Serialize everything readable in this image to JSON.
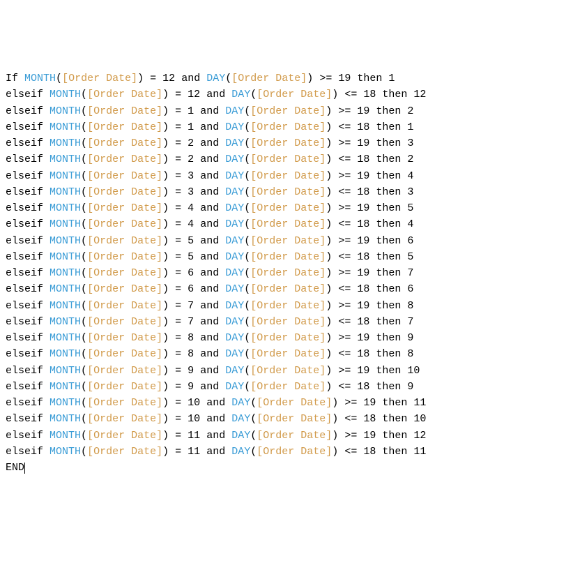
{
  "tokens": {
    "If": "If",
    "elseif": "elseif",
    "and": "and",
    "then": "then",
    "END": "END",
    "MONTH": "MONTH",
    "DAY": "DAY",
    "lp": "(",
    "rp": ")",
    "field": "[Order Date]",
    "eq": "=",
    "ge": ">=",
    "le": "<="
  },
  "lines": [
    {
      "lead": "If",
      "m": "12",
      "cmp": ">=",
      "d": "19",
      "r": "1"
    },
    {
      "lead": "elseif",
      "m": "12",
      "cmp": "<=",
      "d": "18",
      "r": "12"
    },
    {
      "lead": "elseif",
      "m": "1",
      "cmp": ">=",
      "d": "19",
      "r": "2"
    },
    {
      "lead": "elseif",
      "m": "1",
      "cmp": "<=",
      "d": "18",
      "r": "1"
    },
    {
      "lead": "elseif",
      "m": "2",
      "cmp": ">=",
      "d": "19",
      "r": "3"
    },
    {
      "lead": "elseif",
      "m": "2",
      "cmp": "<=",
      "d": "18",
      "r": "2"
    },
    {
      "lead": "elseif",
      "m": "3",
      "cmp": ">=",
      "d": "19",
      "r": "4"
    },
    {
      "lead": "elseif",
      "m": "3",
      "cmp": "<=",
      "d": "18",
      "r": "3"
    },
    {
      "lead": "elseif",
      "m": "4",
      "cmp": ">=",
      "d": "19",
      "r": "5"
    },
    {
      "lead": "elseif",
      "m": "4",
      "cmp": "<=",
      "d": "18",
      "r": "4"
    },
    {
      "lead": "elseif",
      "m": "5",
      "cmp": ">=",
      "d": "19",
      "r": "6"
    },
    {
      "lead": "elseif",
      "m": "5",
      "cmp": "<=",
      "d": "18",
      "r": "5"
    },
    {
      "lead": "elseif",
      "m": "6",
      "cmp": ">=",
      "d": "19",
      "r": "7"
    },
    {
      "lead": "elseif",
      "m": "6",
      "cmp": "<=",
      "d": "18",
      "r": "6"
    },
    {
      "lead": "elseif",
      "m": "7",
      "cmp": ">=",
      "d": "19",
      "r": "8"
    },
    {
      "lead": "elseif",
      "m": "7",
      "cmp": "<=",
      "d": "18",
      "r": "7"
    },
    {
      "lead": "elseif",
      "m": "8",
      "cmp": ">=",
      "d": "19",
      "r": "9"
    },
    {
      "lead": "elseif",
      "m": "8",
      "cmp": "<=",
      "d": "18",
      "r": "8"
    },
    {
      "lead": "elseif",
      "m": "9",
      "cmp": ">=",
      "d": "19",
      "r": "10"
    },
    {
      "lead": "elseif",
      "m": "9",
      "cmp": "<=",
      "d": "18",
      "r": "9"
    },
    {
      "lead": "elseif",
      "m": "10",
      "cmp": ">=",
      "d": "19",
      "r": "11"
    },
    {
      "lead": "elseif",
      "m": "10",
      "cmp": "<=",
      "d": "18",
      "r": "10"
    },
    {
      "lead": "elseif",
      "m": "11",
      "cmp": ">=",
      "d": "19",
      "r": "12"
    },
    {
      "lead": "elseif",
      "m": "11",
      "cmp": "<=",
      "d": "18",
      "r": "11"
    }
  ]
}
